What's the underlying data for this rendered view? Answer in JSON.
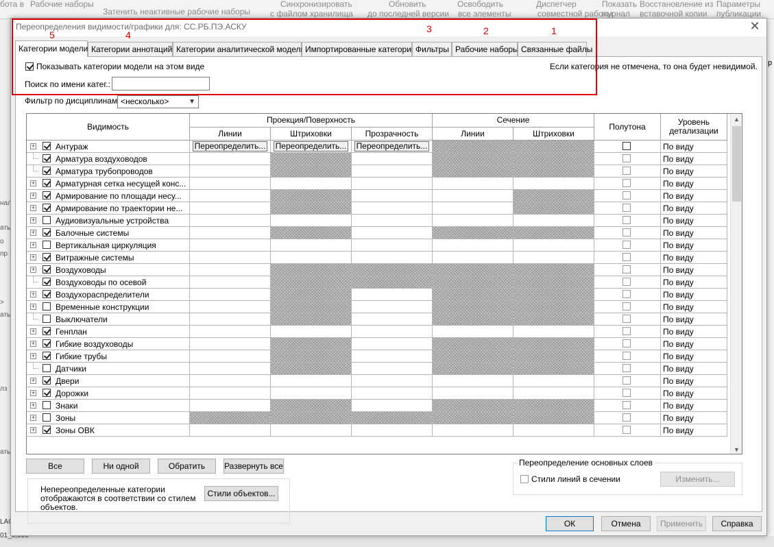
{
  "background": {
    "ribbon": [
      "бота в",
      "Рабочие наборы",
      "Затенить неактивные рабочие наборы",
      "Синхронизировать",
      "Обновить",
      "Освободить",
      "Диспетчер",
      "Показать",
      "Восстановление из",
      "Параметры",
      "с файлом хранилища",
      "до последней версии",
      "все элементы",
      "совместной работы",
      "журнал",
      "вставочной копии",
      "публикации"
    ],
    "left_labels": [
      "нал",
      "ать",
      "о",
      "пр",
      ">",
      "ать",
      "лз",
      "ать"
    ],
    "right_label": "р",
    "bottom_labels": [
      "LAC",
      "01_0,000"
    ]
  },
  "dialog": {
    "title": "Переопределения видимости/графики для: СС.РБ.ПЭ.АСКУ",
    "close_glyph": "✕",
    "annotations": [
      "5",
      "4",
      "3",
      "2",
      "1"
    ],
    "tabs": [
      "Категории модели",
      "Категории аннотаций",
      "Категории аналитической модели",
      "Импортированные категории",
      "Фильтры",
      "Рабочие наборы",
      "Связанные файлы"
    ],
    "show_categories_label": "Показывать категории модели на этом виде",
    "hint": "Если категория не отмечена, то она будет невидимой.",
    "search_label": "Поиск по имени катег.:",
    "search_value": "",
    "discipline_label": "Фильтр по дисциплинам:",
    "discipline_value": "<несколько>",
    "grid": {
      "headers": {
        "visibility": "Видимость",
        "projection": "Проекция/Поверхность",
        "lines": "Линии",
        "patterns": "Штриховки",
        "transparency": "Прозрачность",
        "cut": "Сечение",
        "cut_lines": "Линии",
        "cut_patterns": "Штриховки",
        "halftone": "Полутона",
        "detail_level": "Уровень детализации"
      },
      "override_label": "Переопределить...",
      "detail_value": "По виду",
      "rows": [
        {
          "name": "Антураж",
          "checked": true,
          "expander": true,
          "hatch": [
            0,
            0,
            0,
            1,
            1
          ],
          "selected": true
        },
        {
          "name": "Арматура воздуховодов",
          "checked": true,
          "expander": false,
          "hatch": [
            0,
            1,
            0,
            1,
            1
          ]
        },
        {
          "name": "Арматура трубопроводов",
          "checked": true,
          "expander": false,
          "hatch": [
            0,
            1,
            0,
            1,
            1
          ]
        },
        {
          "name": "Арматурная сетка несущей конс...",
          "checked": true,
          "expander": true,
          "hatch": [
            0,
            0,
            0,
            0,
            0
          ]
        },
        {
          "name": "Армирование по площади несу...",
          "checked": true,
          "expander": true,
          "hatch": [
            0,
            1,
            0,
            0,
            1
          ]
        },
        {
          "name": "Армирование по траектории не...",
          "checked": true,
          "expander": true,
          "hatch": [
            0,
            1,
            0,
            0,
            1
          ]
        },
        {
          "name": "Аудиовизуальные устройства",
          "checked": false,
          "expander": true,
          "hatch": [
            0,
            0,
            0,
            0,
            0
          ]
        },
        {
          "name": "Балочные системы",
          "checked": true,
          "expander": true,
          "hatch": [
            0,
            1,
            0,
            1,
            1
          ]
        },
        {
          "name": "Вертикальная циркуляция",
          "checked": false,
          "expander": true,
          "hatch": [
            0,
            0,
            0,
            0,
            0
          ]
        },
        {
          "name": "Витражные системы",
          "checked": true,
          "expander": true,
          "hatch": [
            0,
            0,
            0,
            0,
            0
          ]
        },
        {
          "name": "Воздуховоды",
          "checked": true,
          "expander": true,
          "hatch": [
            0,
            1,
            1,
            1,
            1
          ]
        },
        {
          "name": "Воздуховоды по осевой",
          "checked": true,
          "expander": false,
          "hatch": [
            0,
            1,
            1,
            1,
            1
          ]
        },
        {
          "name": "Воздухораспределители",
          "checked": true,
          "expander": true,
          "hatch": [
            0,
            1,
            0,
            1,
            1
          ]
        },
        {
          "name": "Временные конструкции",
          "checked": false,
          "expander": true,
          "hatch": [
            0,
            1,
            0,
            1,
            1
          ]
        },
        {
          "name": "Выключатели",
          "checked": false,
          "expander": false,
          "hatch": [
            0,
            1,
            0,
            1,
            1
          ]
        },
        {
          "name": "Генплан",
          "checked": true,
          "expander": true,
          "hatch": [
            0,
            0,
            0,
            0,
            0
          ]
        },
        {
          "name": "Гибкие воздуховоды",
          "checked": true,
          "expander": true,
          "hatch": [
            0,
            1,
            0,
            1,
            1
          ]
        },
        {
          "name": "Гибкие трубы",
          "checked": true,
          "expander": true,
          "hatch": [
            0,
            1,
            0,
            1,
            1
          ]
        },
        {
          "name": "Датчики",
          "checked": false,
          "expander": false,
          "hatch": [
            0,
            1,
            0,
            1,
            1
          ]
        },
        {
          "name": "Двери",
          "checked": true,
          "expander": true,
          "hatch": [
            0,
            0,
            0,
            0,
            0
          ]
        },
        {
          "name": "Дорожки",
          "checked": true,
          "expander": true,
          "hatch": [
            0,
            0,
            0,
            0,
            0
          ]
        },
        {
          "name": "Знаки",
          "checked": false,
          "expander": true,
          "hatch": [
            0,
            1,
            0,
            1,
            1
          ]
        },
        {
          "name": "Зоны",
          "checked": false,
          "expander": true,
          "hatch": [
            1,
            1,
            1,
            1,
            1
          ]
        },
        {
          "name": "Зоны ОВК",
          "checked": true,
          "expander": true,
          "hatch": [
            0,
            0,
            0,
            0,
            0
          ]
        }
      ]
    },
    "buttons": {
      "all": "Все",
      "none": "Ни одной",
      "invert": "Обратить",
      "expand_all": "Развернуть все",
      "object_styles": "Стили объектов...",
      "edit": "Изменить...",
      "ok": "ОК",
      "cancel": "Отмена",
      "apply": "Применить",
      "help": "Справка"
    },
    "note": "Непереопределенные категории отображаются в соответствии со стилем объектов.",
    "base_layers_title": "Переопределение основных слоев",
    "cut_line_styles_label": "Стили линий в сечении"
  }
}
